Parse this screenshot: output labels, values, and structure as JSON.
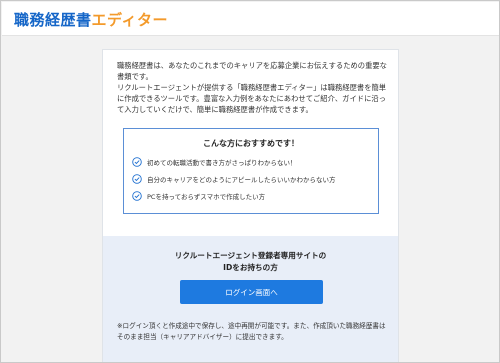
{
  "header": {
    "logo_main": "職務経歴書",
    "logo_sub": "エディター"
  },
  "intro": {
    "paragraph1": "職務経歴書は、あなたのこれまでのキャリアを応募企業にお伝えするための重要な書類です。",
    "paragraph2": "リクルートエージェントが提供する「職務経歴書エディター」は職務経歴書を簡単に作成できるツールです。豊富な入力例をあなたにあわせてご紹介、ガイドに沿って入力していくだけで、簡単に職務経歴書が作成できます。"
  },
  "recommend": {
    "title": "こんな方におすすめです！",
    "items": [
      "初めての転職活動で書き方がさっぱりわからない！",
      "自分のキャリアをどのようにアピールしたらいいかわからない方",
      "PCを持っておらずスマホで作成したい方"
    ],
    "check_color": "#1e6fd0",
    "border_color": "#5b8fd6"
  },
  "login": {
    "heading_line1": "リクルートエージェント登録者専用サイトの",
    "heading_line2": "IDをお持ちの方",
    "button_label": "ログイン画面へ",
    "button_color": "#1e7ae0",
    "note": "※ログイン頂くと作成途中で保存し、途中再開が可能です。また、作成頂いた職務経歴書はそのまま担当（キャリアアドバイザー）に提出できます。"
  },
  "colors": {
    "logo_blue": "#1566c8",
    "logo_orange": "#f39a2b",
    "page_background": "#f2f2f2",
    "login_background": "#e8eef8"
  }
}
